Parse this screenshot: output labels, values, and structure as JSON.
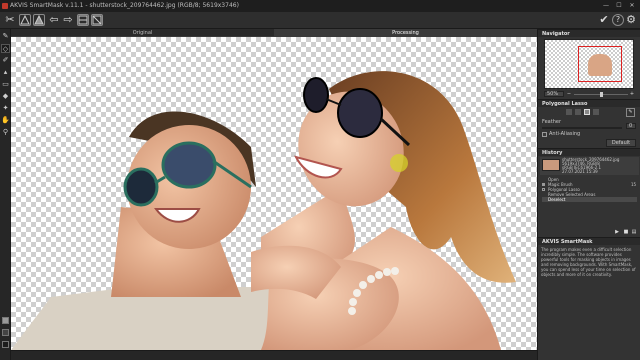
{
  "titlebar": {
    "title": "AKVIS SmartMask v.11.1 - shutterstock_209764462.jpg (RGB/8; 5619x3746)",
    "minimize_icon": "—",
    "maximize_icon": "☐",
    "close_icon": "✕"
  },
  "toolbar": {
    "logo_glyph": "✂",
    "back_icon": "⇦",
    "forward_icon": "⇨",
    "apply_icon": "✔",
    "help_icon": "?",
    "settings_icon": "⚙"
  },
  "tabs": [
    {
      "label": "Original",
      "active": false
    },
    {
      "label": "Processing",
      "active": true
    }
  ],
  "navigator": {
    "title": "Navigator",
    "zoom": "50%",
    "minus_icon": "−",
    "plus_icon": "+"
  },
  "polygonal_lasso": {
    "title": "Polygonal Lasso",
    "feather_label": "Feather",
    "feather_value": "0",
    "antialiasing_label": "Anti-Aliasing",
    "default_button": "Default"
  },
  "history": {
    "title": "History",
    "file": {
      "name": "shutterstock_209764462.jpg",
      "dimensions": "5619x3746, RGB/8",
      "profile": "sRGB IEC61966-2.1",
      "date": "27.07.2021 15:39"
    },
    "items": [
      {
        "label": "Open",
        "count": ""
      },
      {
        "label": "Magic Brush",
        "count": "15"
      },
      {
        "label": "Polygonal Lasso",
        "count": ""
      },
      {
        "label": "Remove Selected Areas",
        "count": ""
      },
      {
        "label": "Deselect",
        "count": ""
      }
    ]
  },
  "about": {
    "title": "AKVIS SmartMask",
    "text": "The program makes even a difficult selection incredibly simple. The software provides powerful tools for masking objects in images and removing backgrounds. With SmartMask, you can spend less of your time on selection of objects and more of it on creativity."
  }
}
